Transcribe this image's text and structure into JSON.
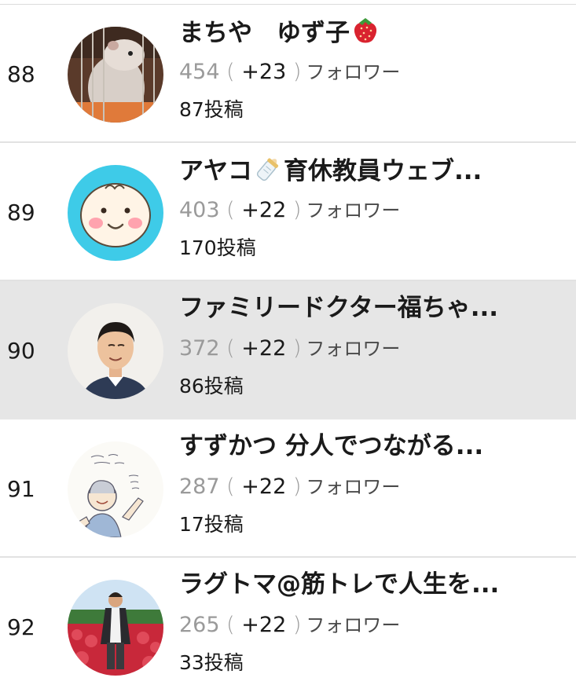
{
  "follower_label": "フォロワー",
  "rows": [
    {
      "rank": "88",
      "name": "まちや　ゆず子",
      "name_emoji": "strawberry-icon",
      "followers": "454",
      "delta": "+23",
      "posts": "87投稿",
      "avatar": "hamster-photo",
      "highlighted": false
    },
    {
      "rank": "89",
      "name_prefix": "アヤコ",
      "name_emoji": "baby-bottle-icon",
      "name_suffix": "育休教員ウェブ...",
      "followers": "403",
      "delta": "+22",
      "posts": "170投稿",
      "avatar": "baby-face-illustration",
      "highlighted": false
    },
    {
      "rank": "90",
      "name": "ファミリードクター福ちゃ...",
      "followers": "372",
      "delta": "+22",
      "posts": "86投稿",
      "avatar": "man-portrait-photo",
      "highlighted": true
    },
    {
      "rank": "91",
      "name": "すずかつ 分人でつながる...",
      "followers": "287",
      "delta": "+22",
      "posts": "17投稿",
      "avatar": "man-sketch-illustration",
      "highlighted": false
    },
    {
      "rank": "92",
      "name": "ラグトマ@筋トレで人生を...",
      "followers": "265",
      "delta": "+22",
      "posts": "33投稿",
      "avatar": "flower-field-photo",
      "highlighted": false
    }
  ]
}
